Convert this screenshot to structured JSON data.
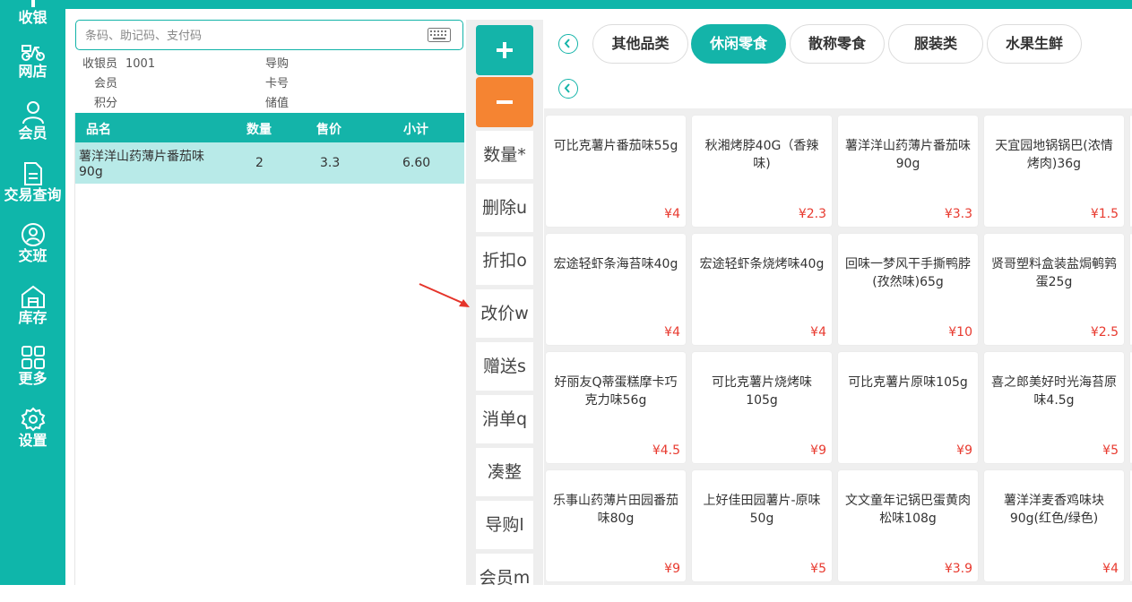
{
  "sidebar": {
    "items": [
      {
        "label": "收银",
        "icon": "cashier-icon"
      },
      {
        "label": "网店",
        "icon": "scooter-icon"
      },
      {
        "label": "会员",
        "icon": "person-icon"
      },
      {
        "label": "交易查询",
        "icon": "document-icon"
      },
      {
        "label": "交班",
        "icon": "shift-icon"
      },
      {
        "label": "库存",
        "icon": "warehouse-icon"
      },
      {
        "label": "更多",
        "icon": "grid-icon"
      },
      {
        "label": "设置",
        "icon": "gear-icon"
      }
    ]
  },
  "search": {
    "placeholder": "条码、助记码、支付码"
  },
  "info": {
    "cashier_label": "收银员",
    "cashier_value": "1001",
    "guide_label": "导购",
    "member_label": "会员",
    "card_label": "卡号",
    "points_label": "积分",
    "stored_label": "储值"
  },
  "cart": {
    "headers": [
      "品名",
      "数量",
      "售价",
      "小计"
    ],
    "rows": [
      {
        "name_line1": "薯洋洋山药薄片番茄味",
        "name_line2": "90g",
        "qty": "2",
        "price": "3.3",
        "subtotal": "6.60"
      }
    ]
  },
  "actions": {
    "buttons": [
      "数量*",
      "删除u",
      "折扣o",
      "改价w",
      "赠送s",
      "消单q",
      "凑整",
      "导购l",
      "会员m"
    ]
  },
  "categories": {
    "tabs": [
      "其他品类",
      "休闲零食",
      "散称零食",
      "服装类",
      "水果生鲜"
    ],
    "active": "休闲零食"
  },
  "products": [
    {
      "name": "可比克薯片番茄味55g",
      "price": "¥4"
    },
    {
      "name": "秋湘烤脖40G（香辣味)",
      "price": "¥2.3"
    },
    {
      "name": "薯洋洋山药薄片番茄味90g",
      "price": "¥3.3"
    },
    {
      "name": "天宜园地锅锅巴(浓情烤肉)36g",
      "price": "¥1.5"
    },
    {
      "name": "宏途轻虾条海苔味40g",
      "price": "¥4"
    },
    {
      "name": "宏途轻虾条烧烤味40g",
      "price": "¥4"
    },
    {
      "name": "回味一梦风干手撕鸭脖(孜然味)65g",
      "price": "¥10"
    },
    {
      "name": "贤哥塑料盒装盐焗鹌鹑蛋25g",
      "price": "¥2.5"
    },
    {
      "name": "好丽友Q蒂蛋糕摩卡巧克力味56g",
      "price": "¥4.5"
    },
    {
      "name": "可比克薯片烧烤味105g",
      "price": "¥9"
    },
    {
      "name": "可比克薯片原味105g",
      "price": "¥9"
    },
    {
      "name": "喜之郎美好时光海苔原味4.5g",
      "price": "¥5"
    },
    {
      "name": "乐事山药薄片田园番茄味80g",
      "price": "¥9"
    },
    {
      "name": "上好佳田园薯片-原味50g",
      "price": "¥5"
    },
    {
      "name": "文文童年记锅巴蛋黄肉松味108g",
      "price": "¥3.9"
    },
    {
      "name": "薯洋洋麦香鸡味块90g(红色/绿色)",
      "price": "¥4"
    }
  ],
  "colors": {
    "accent": "#14b4a9",
    "minus": "#f58432",
    "price": "#e83a2f",
    "selected_row": "#b8eae8"
  }
}
